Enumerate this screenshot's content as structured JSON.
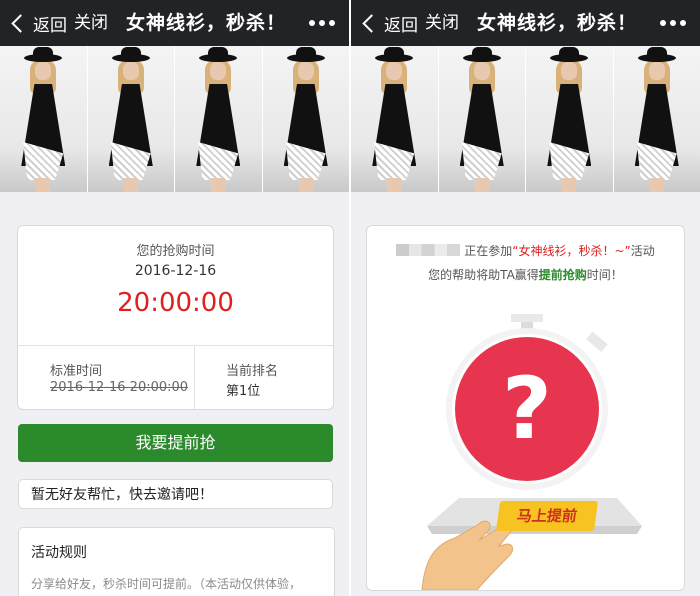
{
  "left": {
    "nav": {
      "back_label": "返回",
      "close_label": "关闭",
      "title": "女神线衫，秒杀！"
    },
    "card": {
      "grab_time_label": "您的抢购时间",
      "grab_date": "2016-12-16",
      "grab_time": "20:00:00",
      "standard_time_label": "标准时间",
      "standard_time_value": "2016-12-16 20:00:00",
      "rank_label": "当前排名",
      "rank_value": "第1位"
    },
    "grab_button_label": "我要提前抢",
    "invite_text": "暂无好友帮忙，快去邀请吧！",
    "rules": {
      "title": "活动规则",
      "desc": "分享给好友，秒杀时间可提前。（本活动仅供体验，"
    }
  },
  "right": {
    "nav": {
      "back_label": "返回",
      "close_label": "关闭",
      "title": "女神线衫，秒杀！"
    },
    "card": {
      "participate_text": "正在参加",
      "activity_name": "“女神线衫，秒杀！~”",
      "activity_suffix": "活动",
      "help_prefix": "您的帮助将助TA赢得",
      "help_highlight": "提前抢购",
      "help_suffix": "时间！",
      "stopwatch_symbol": "?",
      "press_button_label": "马上提前"
    }
  },
  "colors": {
    "accent_green": "#2b8a2b",
    "accent_red": "#e02020",
    "stopwatch_red": "#e8354f",
    "navbar": "#222327"
  },
  "icons": [
    "chevron-left-icon",
    "more-dots-icon",
    "stopwatch-icon",
    "hand-icon"
  ]
}
